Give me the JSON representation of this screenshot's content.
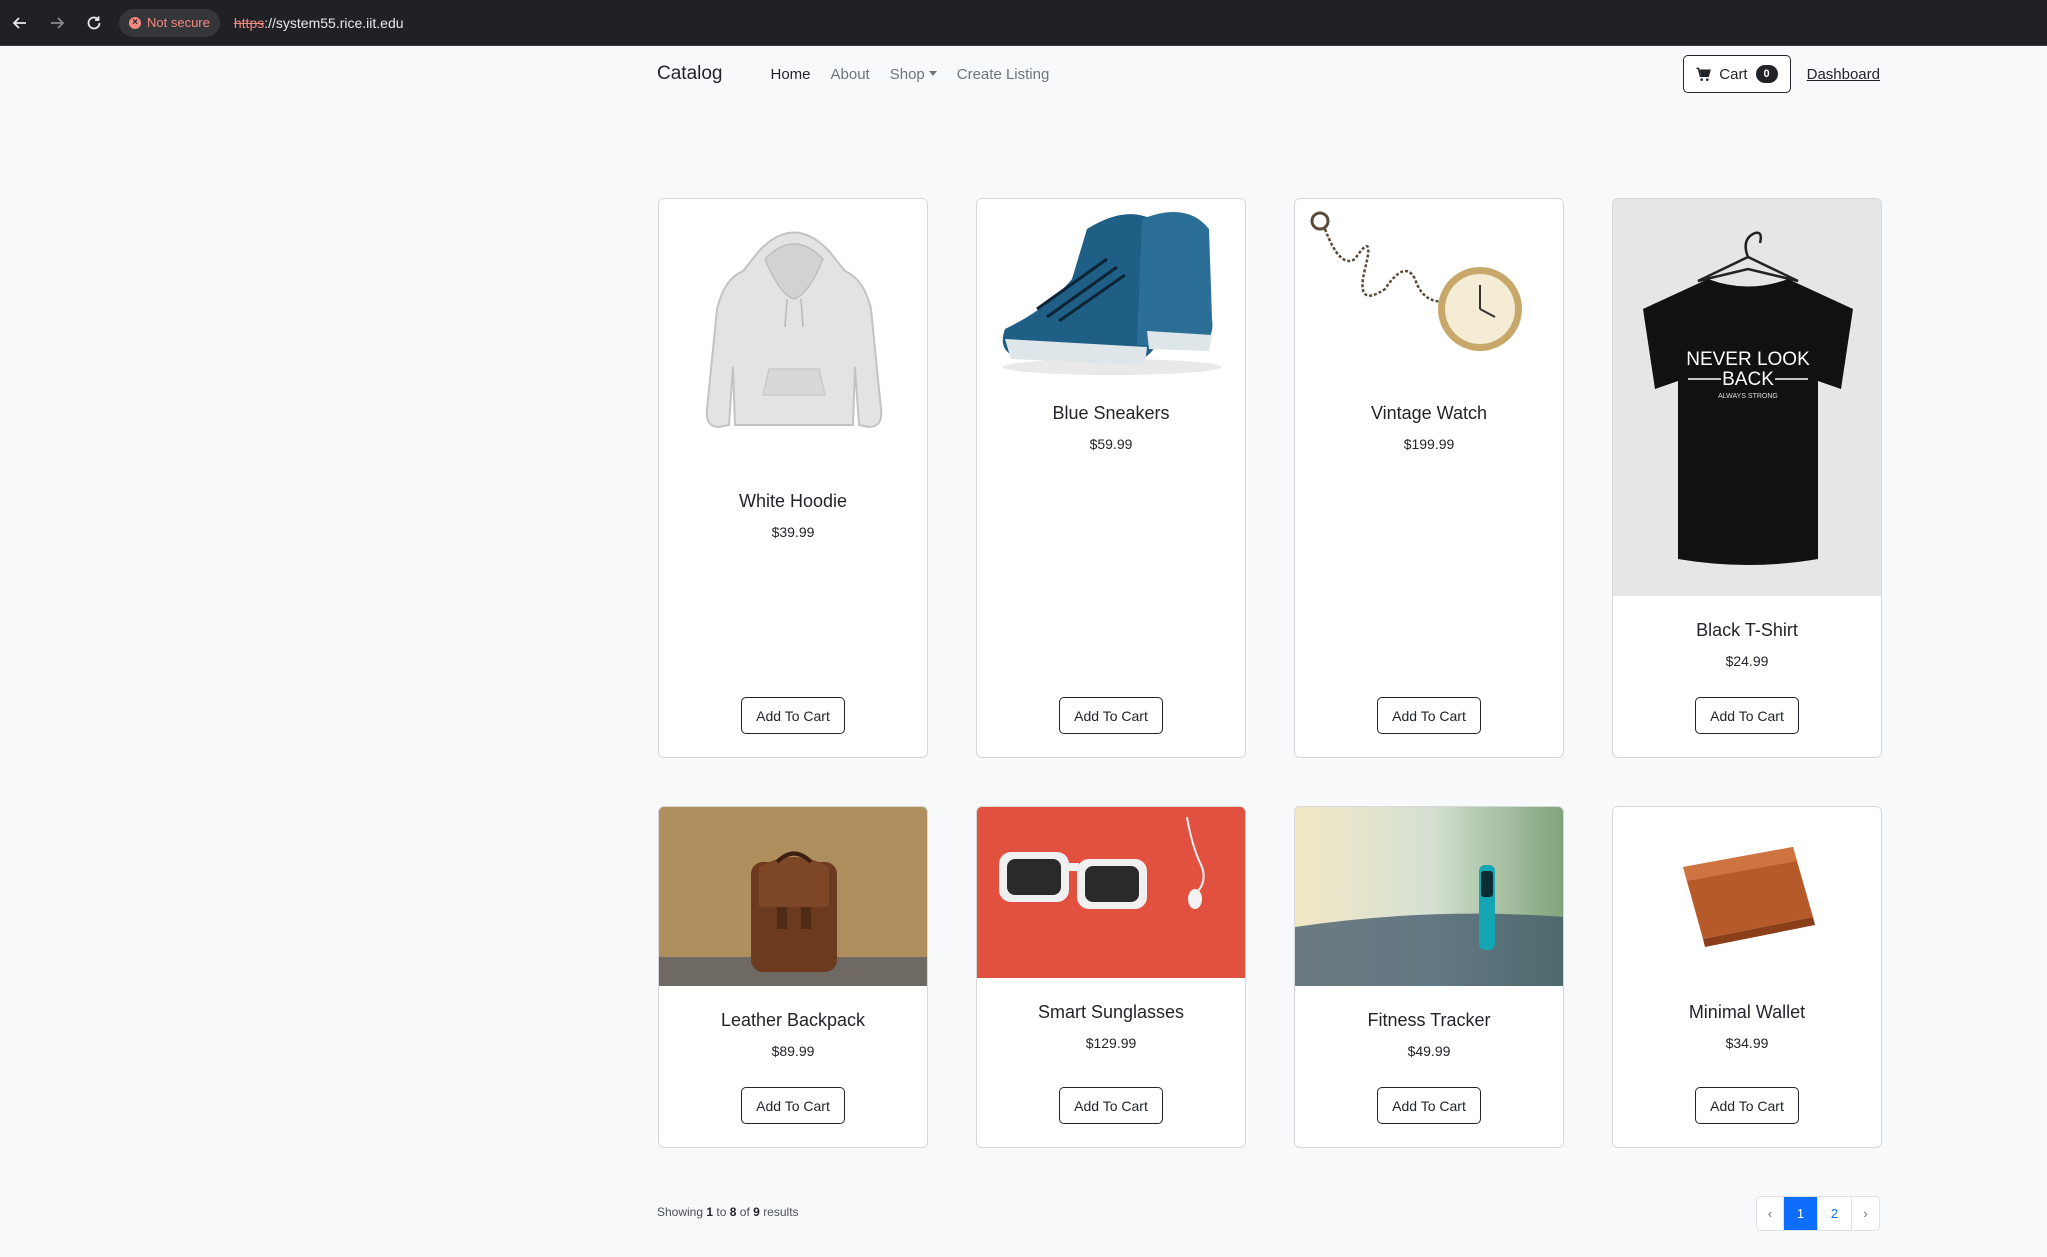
{
  "browser": {
    "security_label": "Not secure",
    "url_scheme": "https",
    "url_rest": "://system55.rice.iit.edu"
  },
  "navbar": {
    "brand": "Catalog",
    "links": [
      "Home",
      "About",
      "Shop",
      "Create Listing"
    ],
    "cart_label": "Cart",
    "cart_count": "0",
    "dashboard_label": "Dashboard"
  },
  "products": [
    {
      "name": "White Hoodie",
      "price": "$39.99",
      "button": "Add To Cart",
      "image": "hoodie"
    },
    {
      "name": "Blue Sneakers",
      "price": "$59.99",
      "button": "Add To Cart",
      "image": "sneakers"
    },
    {
      "name": "Vintage Watch",
      "price": "$199.99",
      "button": "Add To Cart",
      "image": "pocket-watch"
    },
    {
      "name": "Black T-Shirt",
      "price": "$24.99",
      "button": "Add To Cart",
      "image": "t-shirt"
    },
    {
      "name": "Leather Backpack",
      "price": "$89.99",
      "button": "Add To Cart",
      "image": "backpack"
    },
    {
      "name": "Smart Sunglasses",
      "price": "$129.99",
      "button": "Add To Cart",
      "image": "sunglasses"
    },
    {
      "name": "Fitness Tracker",
      "price": "$49.99",
      "button": "Add To Cart",
      "image": "fitness-tracker"
    },
    {
      "name": "Minimal Wallet",
      "price": "$34.99",
      "button": "Add To Cart",
      "image": "wallet"
    }
  ],
  "tshirt_print": {
    "line1": "NEVER LOOK",
    "line2": "BACK",
    "line3": "ALWAYS STRONG"
  },
  "pagination": {
    "showing": "Showing",
    "from": "1",
    "to_word": "to",
    "to": "8",
    "of_word": "of",
    "total": "9",
    "results_word": "results",
    "prev": "‹",
    "pages": [
      "1",
      "2"
    ],
    "current": "1",
    "next": "›"
  }
}
